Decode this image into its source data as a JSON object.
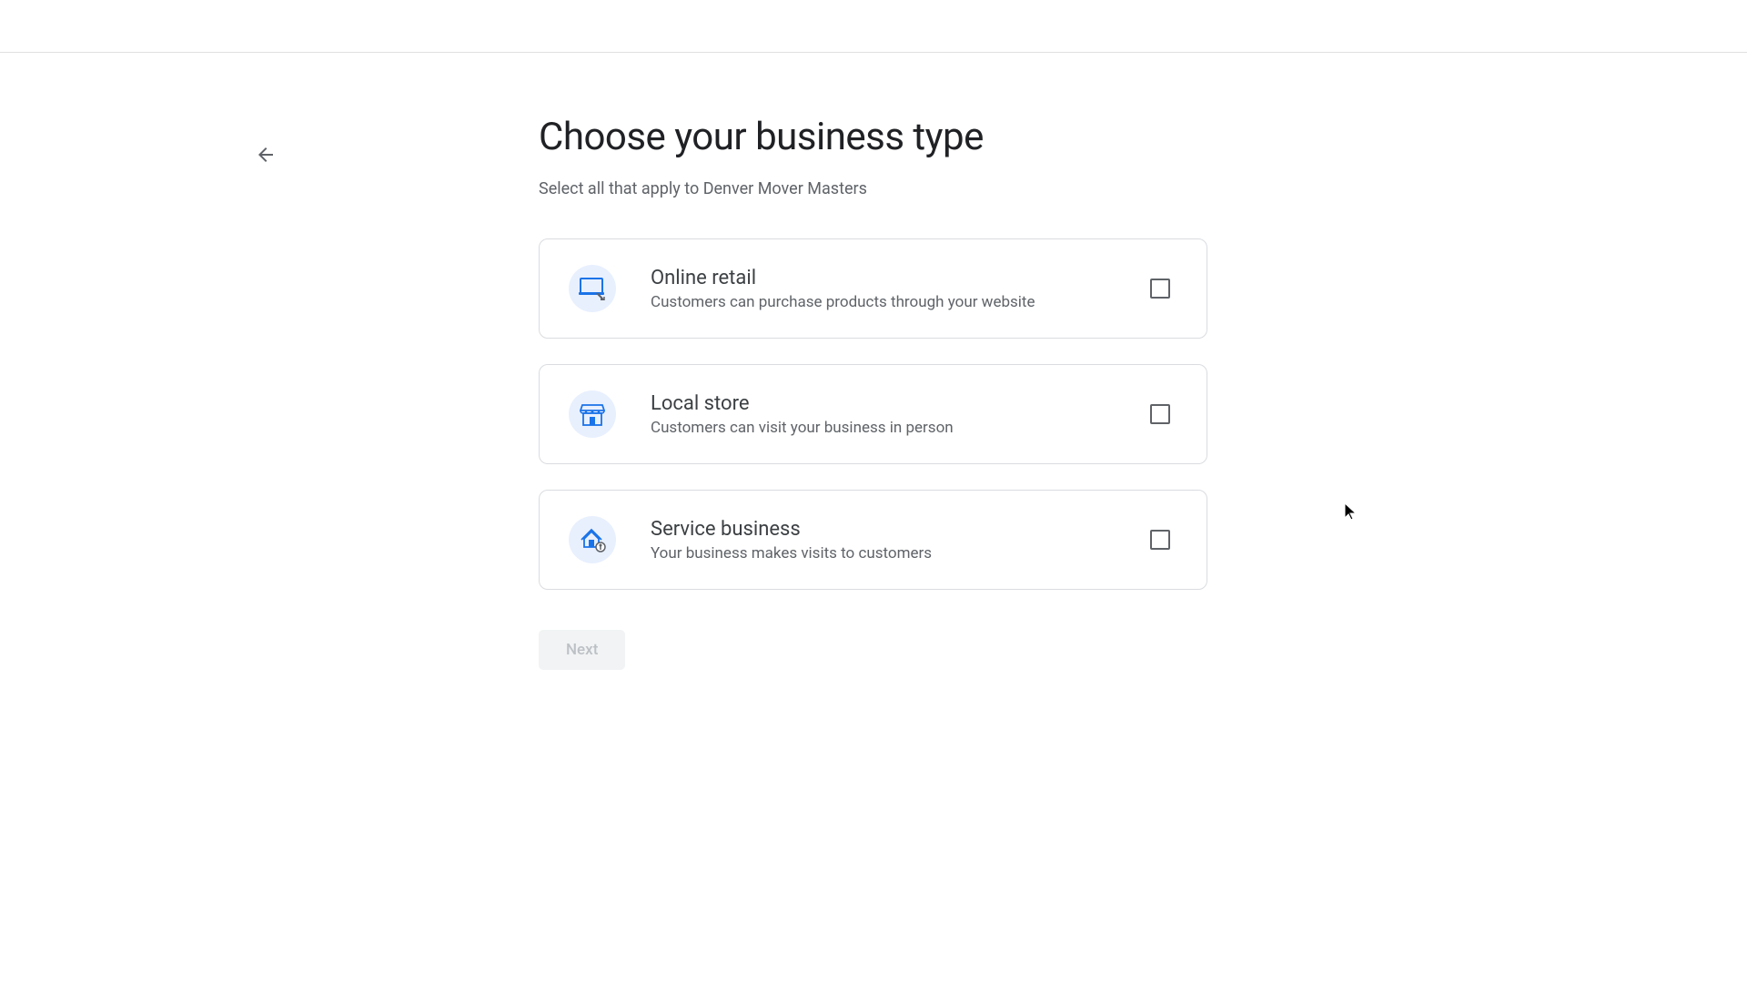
{
  "page": {
    "title": "Choose your business type",
    "subtitle": "Select all that apply to Denver Mover Masters"
  },
  "options": [
    {
      "title": "Online retail",
      "description": "Customers can purchase products through your website"
    },
    {
      "title": "Local store",
      "description": "Customers can visit your business in person"
    },
    {
      "title": "Service business",
      "description": "Your business makes visits to customers"
    }
  ],
  "buttons": {
    "next": "Next"
  }
}
